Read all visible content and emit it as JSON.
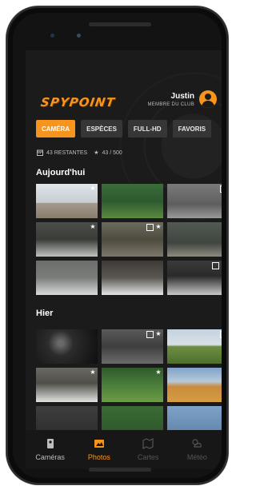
{
  "brand": {
    "logo_text": "SPYPOINT",
    "accent": "#f7941d"
  },
  "user": {
    "name": "Justin",
    "role": "MEMBRE DU CLUB"
  },
  "filters": [
    {
      "label": "CAMÉRA",
      "active": true
    },
    {
      "label": "ESPÈCES",
      "active": false
    },
    {
      "label": "FULL-HD",
      "active": false
    },
    {
      "label": "FAVORIS",
      "active": false
    }
  ],
  "stats": {
    "remaining": "43 RESTANTES",
    "favorites": "43 / 500",
    "calendar_icon": "calendar-icon",
    "favorites_icon": "star-icon"
  },
  "sections": [
    {
      "title": "Aujourd'hui",
      "photos": [
        {
          "scene": "deer in bright winter field",
          "hd": false,
          "star": true
        },
        {
          "scene": "buck in green forest",
          "hd": false,
          "star": false
        },
        {
          "scene": "deer in grey forest night",
          "hd": true,
          "star": false
        },
        {
          "scene": "deer in snowy woods",
          "hd": false,
          "star": true
        },
        {
          "scene": "moose at night",
          "hd": true,
          "star": true
        },
        {
          "scene": "bear in forest",
          "hd": false,
          "star": true
        },
        {
          "scene": "bird on snow",
          "hd": false,
          "star": false
        },
        {
          "scene": "eagle on snow",
          "hd": false,
          "star": false
        },
        {
          "scene": "deer at night",
          "hd": true,
          "star": true
        }
      ]
    },
    {
      "title": "Hier",
      "photos": [
        {
          "scene": "dark night woods",
          "hd": false,
          "star": false
        },
        {
          "scene": "bear in night field",
          "hd": true,
          "star": true
        },
        {
          "scene": "green meadow",
          "hd": true,
          "star": false
        },
        {
          "scene": "deer in snow",
          "hd": false,
          "star": true
        },
        {
          "scene": "deer in green grass",
          "hd": false,
          "star": true
        },
        {
          "scene": "orange autumn field",
          "hd": false,
          "star": true
        },
        {
          "scene": "partial photo",
          "hd": false,
          "star": false
        },
        {
          "scene": "partial photo",
          "hd": false,
          "star": false
        },
        {
          "scene": "partial photo",
          "hd": false,
          "star": false
        }
      ]
    }
  ],
  "tabs": [
    {
      "label": "Caméras",
      "icon": "camera-icon",
      "state": "normal"
    },
    {
      "label": "Photos",
      "icon": "photos-icon",
      "state": "active"
    },
    {
      "label": "Cartes",
      "icon": "map-icon",
      "state": "disabled"
    },
    {
      "label": "Météo",
      "icon": "weather-icon",
      "state": "disabled"
    }
  ]
}
